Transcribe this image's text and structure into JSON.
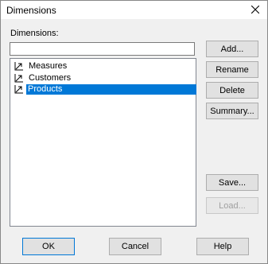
{
  "window": {
    "title": "Dimensions",
    "close_icon": "close-icon"
  },
  "form": {
    "dimensions_label": "Dimensions:",
    "name_value": ""
  },
  "list": {
    "items": [
      {
        "label": "Measures",
        "icon": "dimension-icon",
        "selected": false
      },
      {
        "label": "Customers",
        "icon": "dimension-icon",
        "selected": false
      },
      {
        "label": "Products",
        "icon": "dimension-icon",
        "selected": true
      }
    ]
  },
  "buttons": {
    "add": "Add...",
    "rename": "Rename",
    "delete": "Delete",
    "summary": "Summary...",
    "save": "Save...",
    "load": "Load...",
    "ok": "OK",
    "cancel": "Cancel",
    "help": "Help"
  },
  "colors": {
    "selection": "#0078d7",
    "dialog_bg": "#f0f0f0"
  }
}
